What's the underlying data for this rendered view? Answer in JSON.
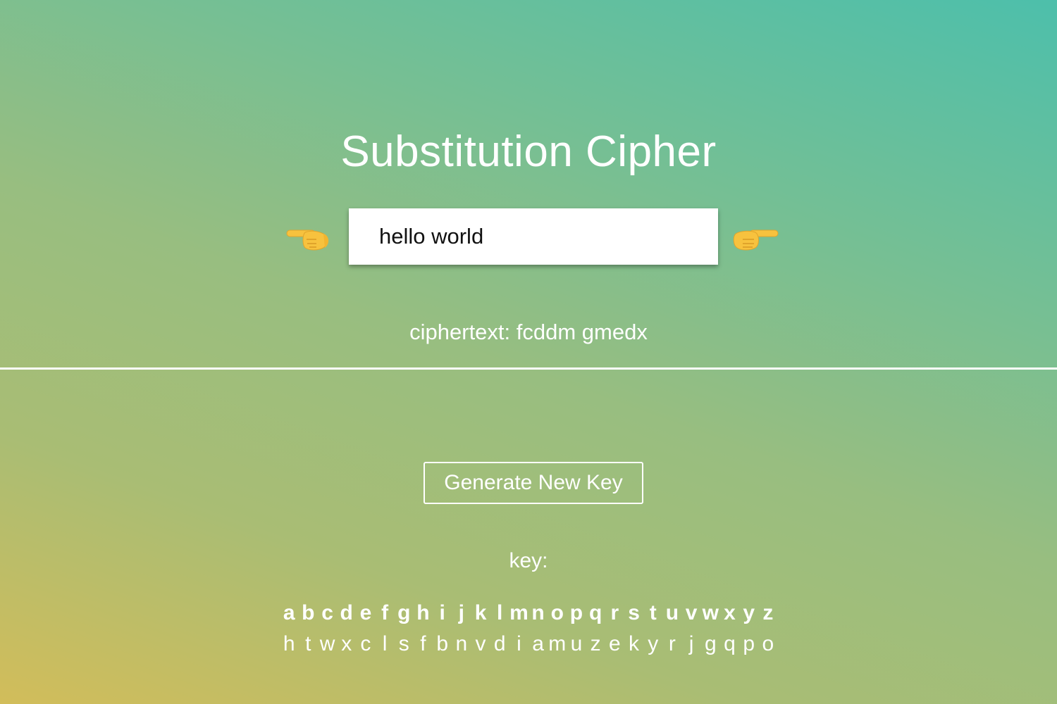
{
  "title": "Substitution Cipher",
  "input": {
    "value": "hello world",
    "placeholder": ""
  },
  "ciphertext_label": "ciphertext: fcddm gmedx",
  "icons": {
    "left": "pointing-right-hand-icon",
    "right": "pointing-right-hand-icon"
  },
  "generate_button": "Generate New Key",
  "key_label": "key:",
  "key": {
    "plain": [
      "a",
      "b",
      "c",
      "d",
      "e",
      "f",
      "g",
      "h",
      "i",
      "j",
      "k",
      "l",
      "m",
      "n",
      "o",
      "p",
      "q",
      "r",
      "s",
      "t",
      "u",
      "v",
      "w",
      "x",
      "y",
      "z"
    ],
    "cipher": [
      "h",
      "t",
      "w",
      "x",
      "c",
      "l",
      "s",
      "f",
      "b",
      "n",
      "v",
      "d",
      "i",
      "a",
      "m",
      "u",
      "z",
      "e",
      "k",
      "y",
      "r",
      "j",
      "g",
      "q",
      "p",
      "o"
    ]
  },
  "colors": {
    "gradient_top": "#4dbfab",
    "gradient_bottom": "#d2bd5a",
    "text": "#ffffff"
  }
}
